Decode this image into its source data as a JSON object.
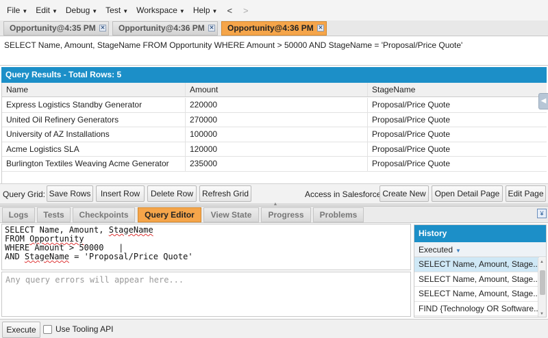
{
  "menu": {
    "items": [
      "File",
      "Edit",
      "Debug",
      "Test",
      "Workspace",
      "Help"
    ],
    "back": "<",
    "forward": ">"
  },
  "query_tabs": [
    {
      "label": "Opportunity@4:35 PM",
      "active": false
    },
    {
      "label": "Opportunity@4:36 PM",
      "active": false
    },
    {
      "label": "Opportunity@4:36 PM",
      "active": true
    }
  ],
  "soql_line": "SELECT Name, Amount, StageName FROM Opportunity WHERE Amount > 50000 AND StageName = 'Proposal/Price Quote'",
  "results": {
    "title": "Query Results - Total Rows: 5",
    "columns": [
      "Name",
      "Amount",
      "StageName"
    ],
    "rows": [
      [
        "Express Logistics Standby Generator",
        "220000",
        "Proposal/Price Quote"
      ],
      [
        "United Oil Refinery Generators",
        "270000",
        "Proposal/Price Quote"
      ],
      [
        "University of AZ Installations",
        "100000",
        "Proposal/Price Quote"
      ],
      [
        "Acme Logistics SLA",
        "120000",
        "Proposal/Price Quote"
      ],
      [
        "Burlington Textiles Weaving Acme Generator",
        "235000",
        "Proposal/Price Quote"
      ]
    ]
  },
  "query_grid": {
    "label": "Query Grid:",
    "buttons": [
      "Save Rows",
      "Insert Row",
      "Delete Row",
      "Refresh Grid"
    ],
    "salesforce_label": "Access in Salesforce:",
    "salesforce_buttons": [
      "Create New",
      "Open Detail Page",
      "Edit Page"
    ]
  },
  "bottom_tabs": [
    {
      "label": "Logs",
      "active": false
    },
    {
      "label": "Tests",
      "active": false
    },
    {
      "label": "Checkpoints",
      "active": false
    },
    {
      "label": "Query Editor",
      "active": true
    },
    {
      "label": "View State",
      "active": false
    },
    {
      "label": "Progress",
      "active": false
    },
    {
      "label": "Problems",
      "active": false
    }
  ],
  "editor": {
    "lines": [
      "SELECT Name, Amount, StageName",
      "FROM Opportunity",
      "WHERE Amount > 50000   |",
      "AND StageName = 'Proposal/Price Quote'"
    ],
    "errors_placeholder": "Any query errors will appear here..."
  },
  "history": {
    "title": "History",
    "column": "Executed",
    "items": [
      "SELECT Name, Amount, Stage...",
      "SELECT Name, Amount, Stage...",
      "SELECT Name, Amount, Stage...",
      "FIND {Technology OR Software..."
    ],
    "selected_index": 0
  },
  "footer": {
    "execute_label": "Execute",
    "tooling_label": "Use Tooling API",
    "tooling_checked": false
  },
  "colors": {
    "accent_blue": "#1c8fc8",
    "active_tab_orange": "#f5a54a"
  }
}
